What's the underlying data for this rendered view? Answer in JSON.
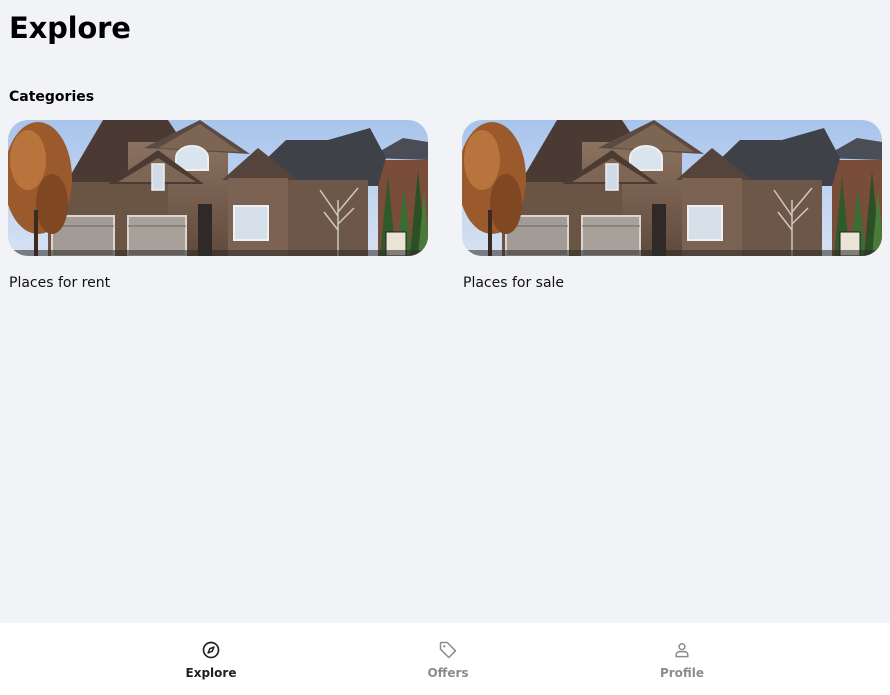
{
  "header": {
    "title": "Explore"
  },
  "categories": {
    "title": "Categories",
    "items": [
      {
        "label": "Places for rent",
        "image": "house-photo"
      },
      {
        "label": "Places for sale",
        "image": "house-photo"
      }
    ]
  },
  "bottom_nav": {
    "items": [
      {
        "label": "Explore",
        "icon": "compass-icon",
        "active": true
      },
      {
        "label": "Offers",
        "icon": "tag-icon",
        "active": false
      },
      {
        "label": "Profile",
        "icon": "user-icon",
        "active": false
      }
    ]
  },
  "colors": {
    "background": "#f2f3f7",
    "nav_background": "#ffffff",
    "nav_active": "#222222",
    "nav_inactive": "#8c8c8c"
  }
}
